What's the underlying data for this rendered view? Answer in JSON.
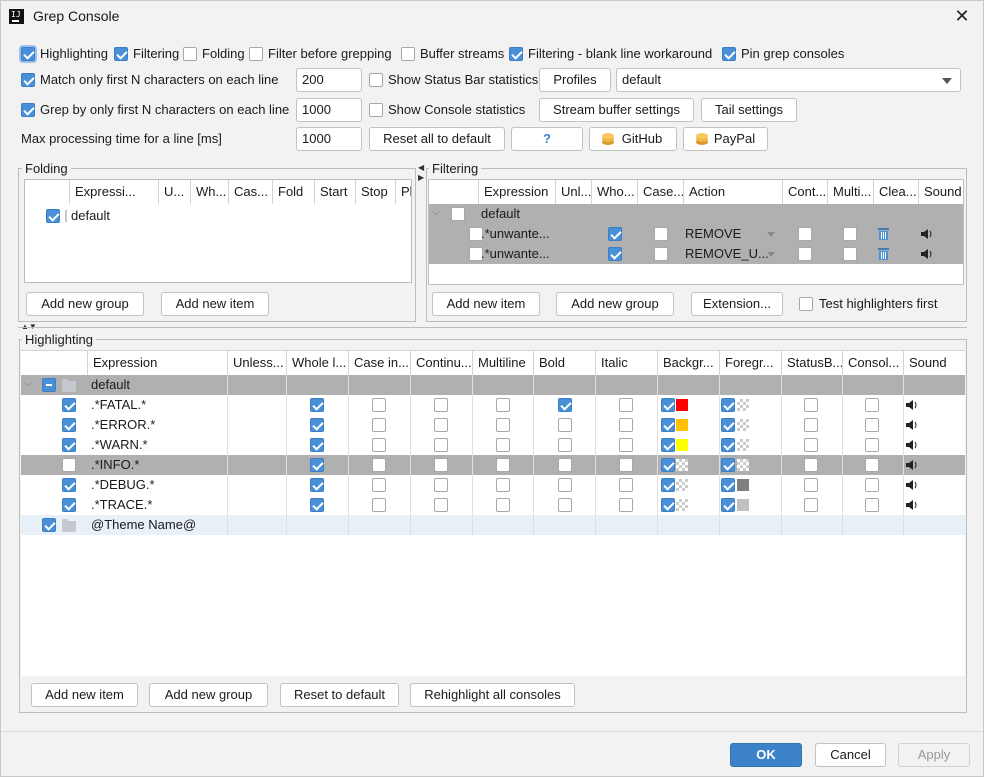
{
  "window": {
    "title": "Grep Console"
  },
  "top_options": {
    "row1": [
      {
        "label": "Highlighting",
        "checked": true
      },
      {
        "label": "Filtering",
        "checked": true
      },
      {
        "label": "Folding",
        "checked": false
      },
      {
        "label": "Filter before grepping",
        "checked": false
      },
      {
        "label": "Buffer streams",
        "checked": false
      },
      {
        "label": "Filtering - blank line workaround",
        "checked": true
      },
      {
        "label": "Pin grep consoles",
        "checked": true
      }
    ],
    "match_first_n": {
      "label": "Match only first N characters on each line",
      "checked": true,
      "value": "200"
    },
    "grep_first_n": {
      "label": "Grep by only first N characters on each line",
      "checked": true,
      "value": "1000"
    },
    "max_time": {
      "label": "Max processing time for a line [ms]",
      "value": "1000"
    },
    "status_bar_stats": {
      "label": "Show Status Bar statistics",
      "checked": false
    },
    "console_stats": {
      "label": "Show Console statistics",
      "checked": false
    },
    "profiles_button": "Profiles",
    "profile_select": "default",
    "stream_buffer_button": "Stream buffer settings",
    "tail_button": "Tail settings",
    "reset_all_button": "Reset all to default",
    "help_button": "?",
    "github_button": "GitHub",
    "paypal_button": "PayPal"
  },
  "folding": {
    "title": "Folding",
    "columns": [
      "Expressi...",
      "U...",
      "Wh...",
      "Cas...",
      "Fold",
      "Start",
      "Stop",
      "Pla..."
    ],
    "rows": [
      {
        "name": "default",
        "checked": true
      }
    ],
    "add_group_button": "Add new group",
    "add_item_button": "Add new item"
  },
  "filtering": {
    "title": "Filtering",
    "columns": [
      "Expression",
      "Unl...",
      "Who...",
      "Case...",
      "Action",
      "Cont...",
      "Multi...",
      "Clea...",
      "Sound"
    ],
    "group": "default",
    "rows": [
      {
        "expression": ".*unwante...",
        "whole": true,
        "case": false,
        "action": "REMOVE",
        "cont": false,
        "multi": false
      },
      {
        "expression": ".*unwante...",
        "whole": true,
        "case": false,
        "action": "REMOVE_U...",
        "cont": false,
        "multi": false
      }
    ],
    "add_item_button": "Add new item",
    "add_group_button": "Add new group",
    "extension_button": "Extension...",
    "test_highlighters": {
      "label": "Test highlighters first",
      "checked": false
    }
  },
  "highlighting": {
    "title": "Highlighting",
    "columns": [
      "Expression",
      "Unless...",
      "Whole l...",
      "Case in...",
      "Continu...",
      "Multiline",
      "Bold",
      "Italic",
      "Backgr...",
      "Foregr...",
      "StatusB...",
      "Consol...",
      "Sound"
    ],
    "group": "default",
    "rows": [
      {
        "expression": ".*FATAL.*",
        "enabled": true,
        "bold": true,
        "bg": "#ff0000",
        "fg": "checker"
      },
      {
        "expression": ".*ERROR.*",
        "enabled": true,
        "bold": false,
        "bg": "#ffc000",
        "fg": "checker"
      },
      {
        "expression": ".*WARN.*",
        "enabled": true,
        "bold": false,
        "bg": "#ffff00",
        "fg": "checker"
      },
      {
        "expression": ".*INFO.*",
        "enabled": false,
        "bold": false,
        "bg": "checker",
        "fg": "checker"
      },
      {
        "expression": ".*DEBUG.*",
        "enabled": true,
        "bold": false,
        "bg": "checker",
        "fg": "#808080"
      },
      {
        "expression": ".*TRACE.*",
        "enabled": true,
        "bold": false,
        "bg": "checker",
        "fg": "#c0c0c0"
      }
    ],
    "theme_row": "@Theme Name@",
    "add_item_button": "Add new item",
    "add_group_button": "Add new group",
    "reset_button": "Reset to default",
    "rehighlight_button": "Rehighlight all consoles"
  },
  "footer": {
    "ok": "OK",
    "cancel": "Cancel",
    "apply": "Apply"
  },
  "colors": {
    "accent": "#4a90d9",
    "selected_row": "#b0b0b0",
    "primary_button": "#3b82c9"
  }
}
